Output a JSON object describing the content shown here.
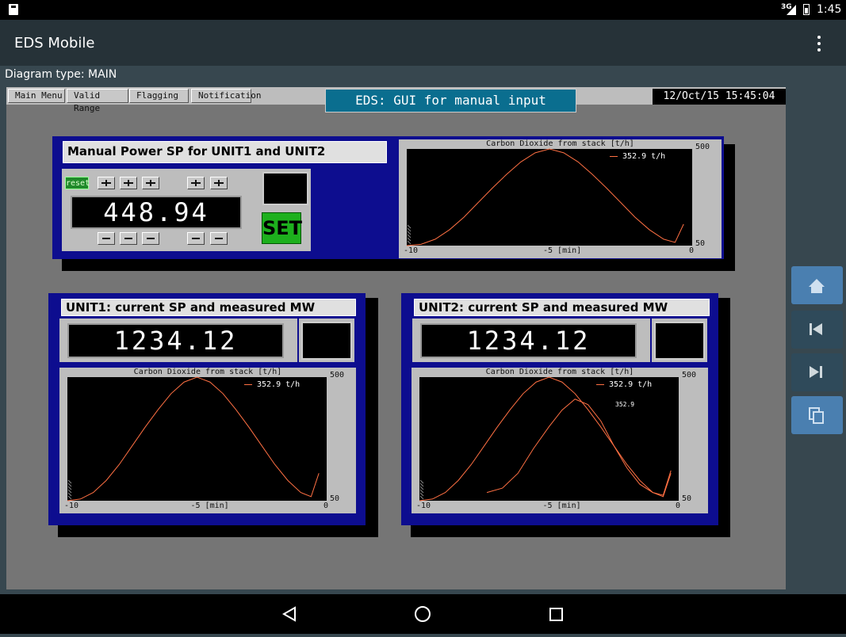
{
  "status_bar": {
    "network": "3G",
    "time": "1:45"
  },
  "app_bar": {
    "title": "EDS Mobile"
  },
  "diagram_type": "Diagram type: MAIN",
  "menu_buttons": [
    "Main Menu",
    "Valid Range",
    "Flagging",
    "Notification"
  ],
  "header": {
    "title": "EDS: GUI for manual input",
    "datetime": "12/Oct/15  15:45:04"
  },
  "manual_panel": {
    "title": "Manual Power SP for UNIT1 and UNIT2",
    "reset_label": "reset",
    "value": "448.94",
    "set_label": "SET"
  },
  "unit1": {
    "title": "UNIT1: current SP and measured MW",
    "value": "1234.12"
  },
  "unit2": {
    "title": "UNIT2: current SP and measured MW",
    "value": "1234.12",
    "marker_value": "352.9"
  },
  "chart_data": [
    {
      "type": "line",
      "title": "Carbon Dioxide from stack [t/h]",
      "x_ticks": [
        "-10",
        "-5 [min]",
        "0"
      ],
      "y_ticks": [
        "500",
        "50"
      ],
      "xlim": [
        -10,
        0
      ],
      "ylim": [
        50,
        500
      ],
      "series": [
        {
          "name": "352.9  t/h",
          "color": "#ff7043",
          "x": [
            -10,
            -9.5,
            -9,
            -8.5,
            -8,
            -7.5,
            -7,
            -6.5,
            -6,
            -5.5,
            -5,
            -4.5,
            -4,
            -3.5,
            -3,
            -2.5,
            -2,
            -1.5,
            -1,
            -0.6,
            -0.3
          ],
          "y": [
            50,
            56,
            80,
            124,
            182,
            250,
            318,
            382,
            440,
            482,
            500,
            482,
            440,
            382,
            318,
            250,
            182,
            124,
            80,
            65,
            150
          ]
        }
      ]
    },
    {
      "type": "line",
      "title": "Carbon Dioxide from stack [t/h]",
      "x_ticks": [
        "-10",
        "-5 [min]",
        "0"
      ],
      "y_ticks": [
        "500",
        "50"
      ],
      "xlim": [
        -10,
        0
      ],
      "ylim": [
        50,
        500
      ],
      "series": [
        {
          "name": "352.9  t/h",
          "color": "#ff7043",
          "x": [
            -10,
            -9.5,
            -9,
            -8.5,
            -8,
            -7.5,
            -7,
            -6.5,
            -6,
            -5.5,
            -5,
            -4.5,
            -4,
            -3.5,
            -3,
            -2.5,
            -2,
            -1.5,
            -1,
            -0.6,
            -0.3
          ],
          "y": [
            50,
            56,
            80,
            124,
            182,
            250,
            318,
            382,
            440,
            482,
            500,
            482,
            440,
            382,
            318,
            250,
            182,
            124,
            80,
            65,
            150
          ]
        }
      ]
    },
    {
      "type": "line",
      "title": "Carbon Dioxide from stack [t/h]",
      "x_ticks": [
        "-10",
        "-5 [min]",
        "0"
      ],
      "y_ticks": [
        "500",
        "50"
      ],
      "xlim": [
        -10,
        0
      ],
      "ylim": [
        50,
        500
      ],
      "series": [
        {
          "name": "352.9  t/h",
          "color": "#ff7043",
          "x": [
            -10,
            -9.5,
            -9,
            -8.5,
            -8,
            -7.5,
            -7,
            -6.5,
            -6,
            -5.5,
            -5,
            -4.5,
            -4,
            -3.5,
            -3,
            -2.5,
            -2,
            -1.5,
            -1,
            -0.6,
            -0.3
          ],
          "y": [
            50,
            56,
            80,
            124,
            182,
            250,
            318,
            382,
            440,
            482,
            500,
            482,
            440,
            382,
            318,
            250,
            182,
            124,
            80,
            65,
            150
          ]
        },
        {
          "name": "",
          "color": "#ff7043",
          "x": [
            -7.4,
            -6.8,
            -6.2,
            -5.6,
            -5,
            -4.5,
            -4,
            -3.5,
            -3,
            -2.5,
            -2,
            -1.5,
            -1,
            -0.6,
            -0.3
          ],
          "y": [
            80,
            96,
            150,
            240,
            320,
            380,
            420,
            400,
            340,
            250,
            170,
            110,
            80,
            70,
            160
          ]
        }
      ]
    }
  ]
}
